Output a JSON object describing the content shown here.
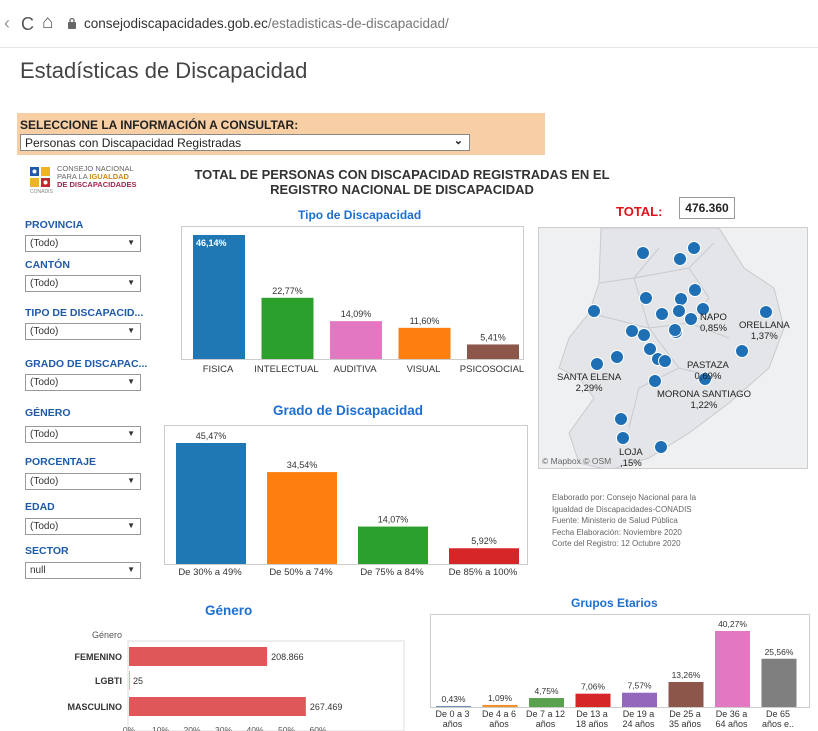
{
  "browser": {
    "back": "‹",
    "reload": "C",
    "home": "⌂",
    "url_domain": "consejodiscapacidades.gob.ec",
    "url_path": "/estadisticas-de-discapacidad/"
  },
  "page_title": "Estadísticas de Discapacidad",
  "selector": {
    "label": "SELECCIONE LA INFORMACIÓN A CONSULTAR:",
    "value": "Personas con Discapacidad Registradas"
  },
  "logo": {
    "line1": "CONSEJO NACIONAL",
    "line2a": "PARA LA ",
    "line2b": "IGUALDAD",
    "line3": "DE DISCAPACIDADES",
    "tag": "CONADIS"
  },
  "main_title_line1": "TOTAL DE PERSONAS CON DISCAPACIDAD REGISTRADAS EN EL",
  "main_title_line2": "REGISTRO NACIONAL DE DISCAPACIDAD",
  "filters": [
    {
      "label": "PROVINCIA",
      "value": "(Todo)"
    },
    {
      "label": "CANTÓN",
      "value": "(Todo)"
    },
    {
      "label": "TIPO DE DISCAPACID...",
      "value": "(Todo)"
    },
    {
      "label": "GRADO DE DISCAPAC...",
      "value": "(Todo)"
    },
    {
      "label": "GÉNERO",
      "value": "(Todo)"
    },
    {
      "label": "PORCENTAJE",
      "value": "(Todo)"
    },
    {
      "label": "EDAD",
      "value": "(Todo)"
    },
    {
      "label": "SECTOR",
      "value": "null"
    }
  ],
  "total": {
    "label": "TOTAL:",
    "value": "476.360"
  },
  "map": {
    "credit": "© Mapbox © OSM",
    "labels": [
      {
        "name": "NAPO",
        "pct": "0,85%"
      },
      {
        "name": "ORELLANA",
        "pct": "1,37%"
      },
      {
        "name": "PASTAZA",
        "pct": "0,69%"
      },
      {
        "name": "SANTA ELENA",
        "pct": "2,29%"
      },
      {
        "name": "MORONA SANTIAGO",
        "pct": "1,22%"
      },
      {
        "name": "LOJA",
        "pct": ",15%"
      }
    ]
  },
  "credits": [
    "Elaborado por: Consejo Nacional para la",
    "Igualdad de Discapacidades-CONADIS",
    "Fuente: Ministerio de Salud Pública",
    "Fecha Elaboración: Noviembre 2020",
    "Corte del Registro: 12 Octubre 2020"
  ],
  "chart_data": [
    {
      "type": "bar",
      "title": "Tipo de Discapacidad",
      "categories": [
        "FISICA",
        "INTELECTUAL",
        "AUDITIVA",
        "VISUAL",
        "PSICOSOCIAL"
      ],
      "values": [
        46.14,
        22.77,
        14.09,
        11.6,
        5.41
      ],
      "labels": [
        "46,14%",
        "22,77%",
        "14,09%",
        "11,60%",
        "5,41%"
      ],
      "colors": [
        "#1f77b4",
        "#2ca02c",
        "#e377c2",
        "#ff7f0e",
        "#8c564b"
      ]
    },
    {
      "type": "bar",
      "title": "Grado de Discapacidad",
      "categories": [
        "De 30% a 49%",
        "De 50% a 74%",
        "De 75% a 84%",
        "De 85% a 100%"
      ],
      "values": [
        45.47,
        34.54,
        14.07,
        5.92
      ],
      "labels": [
        "45,47%",
        "34,54%",
        "14,07%",
        "5,92%"
      ],
      "colors": [
        "#1f77b4",
        "#ff7f0e",
        "#2ca02c",
        "#d62728"
      ]
    },
    {
      "type": "bar",
      "orientation": "horizontal",
      "title": "Género",
      "axis_title": "Género",
      "categories": [
        "FEMENINO",
        "LGBTI",
        "MASCULINO"
      ],
      "values": [
        208866,
        25,
        267469
      ],
      "labels": [
        "208.866",
        "25",
        "267.469"
      ],
      "x_ticks": [
        "0%",
        "10%",
        "20%",
        "30%",
        "40%",
        "50%",
        "60%"
      ],
      "color": "#e05759"
    },
    {
      "type": "bar",
      "title": "Grupos Etarios",
      "categories": [
        [
          "De 0 a 3",
          "años"
        ],
        [
          "De 4 a 6",
          "años"
        ],
        [
          "De 7 a 12",
          "años"
        ],
        [
          "De 13 a",
          "18 años"
        ],
        [
          "De 19 a",
          "24 años"
        ],
        [
          "De 25 a",
          "35 años"
        ],
        [
          "De 36 a",
          "64 años"
        ],
        [
          "De 65",
          "años e.."
        ]
      ],
      "values": [
        0.43,
        1.09,
        4.75,
        7.06,
        7.57,
        13.26,
        40.27,
        25.56
      ],
      "labels": [
        "0,43%",
        "1,09%",
        "4,75%",
        "7,06%",
        "7,57%",
        "13,26%",
        "40,27%",
        "25,56%"
      ],
      "colors": [
        "#4e79a7",
        "#f28e2b",
        "#59a14f",
        "#d62728",
        "#9467bd",
        "#8c564b",
        "#e377c2",
        "#7f7f7f"
      ]
    }
  ]
}
